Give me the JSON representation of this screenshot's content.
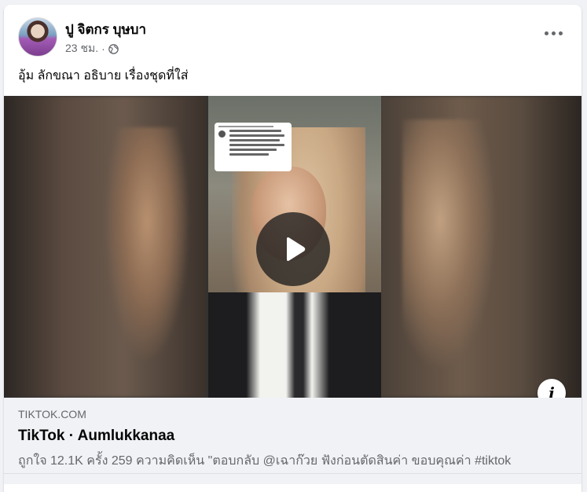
{
  "post": {
    "author": "ปู จิตกร บุษบา",
    "time": "23 ชม.",
    "separator": "·",
    "privacy_icon": "globe-icon",
    "text": "อุ้ม ลักขณา อธิบาย เรื่องชุดที่ใส่"
  },
  "video": {
    "play_icon": "play-icon",
    "info_label": "i"
  },
  "link_preview": {
    "domain": "TIKTOK.COM",
    "title": "TikTok · Aumlukkanaa",
    "description": "ถูกใจ 12.1K ครั้ง 259 ความคิดเห็น \"ตอบกลับ @เฉาก๊วย ฟังก่อนตัดสินค่า ขอบคุณค่า #tiktok"
  },
  "colors": {
    "background": "#f0f2f5",
    "card": "#ffffff",
    "text_primary": "#050505",
    "text_secondary": "#65676b"
  }
}
